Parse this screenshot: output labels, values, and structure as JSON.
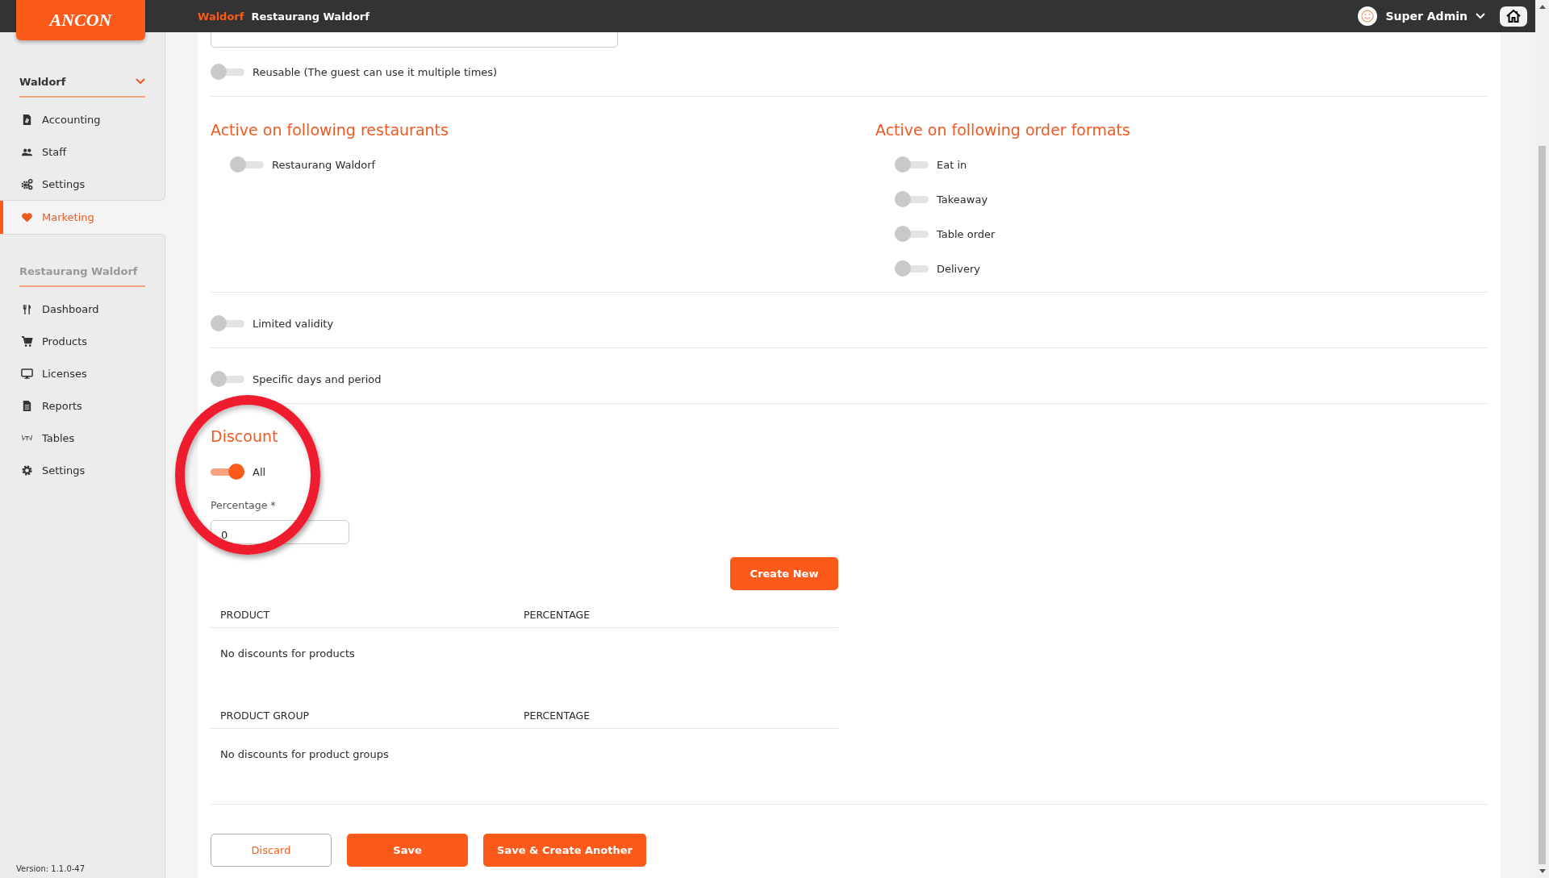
{
  "header": {
    "logo": "ANCON",
    "breadcrumb": [
      {
        "text": "Waldorf",
        "highlighted": true
      },
      {
        "text": "Restaurang Waldorf",
        "highlighted": false
      }
    ],
    "user": "Super Admin"
  },
  "sidebar": {
    "groups": [
      {
        "title": "Waldorf",
        "collapsible": true,
        "items": [
          {
            "label": "Accounting",
            "selected": false
          },
          {
            "label": "Staff",
            "selected": false
          },
          {
            "label": "Settings",
            "selected": false
          }
        ]
      },
      {
        "title": "Marketing",
        "kind": "link",
        "selected": true
      },
      {
        "title": "Restaurang Waldorf",
        "collapsible": false,
        "items": [
          {
            "label": "Dashboard",
            "selected": false
          },
          {
            "label": "Products",
            "selected": false
          },
          {
            "label": "Licenses",
            "selected": false
          },
          {
            "label": "Reports",
            "selected": false
          },
          {
            "label": "Tables",
            "selected": false
          },
          {
            "label": "Settings",
            "selected": false
          }
        ]
      }
    ],
    "version": "Version: 1.1.0-47"
  },
  "form": {
    "reusable": {
      "label": "Reusable (The guest can use it multiple times)",
      "on": false
    },
    "restaurants": {
      "title": "Active on following restaurants",
      "items": [
        {
          "label": "Restaurang Waldorf",
          "on": false
        }
      ]
    },
    "order_formats": {
      "title": "Active on following order formats",
      "items": [
        {
          "label": "Eat in",
          "on": false
        },
        {
          "label": "Takeaway",
          "on": false
        },
        {
          "label": "Table order",
          "on": false
        },
        {
          "label": "Delivery",
          "on": false
        }
      ]
    },
    "limited_validity": {
      "label": "Limited validity",
      "on": false
    },
    "specific_days": {
      "label": "Specific days and period",
      "on": false
    },
    "discount": {
      "title": "Discount",
      "all": {
        "label": "All",
        "on": true
      },
      "percentage": {
        "label": "Percentage *",
        "value": "0"
      },
      "create_button": "Create New",
      "tables": [
        {
          "columns": [
            "PRODUCT",
            "PERCENTAGE"
          ],
          "empty": "No discounts for products"
        },
        {
          "columns": [
            "PRODUCT GROUP",
            "PERCENTAGE"
          ],
          "empty": "No discounts for product groups"
        }
      ]
    },
    "buttons": [
      {
        "label": "Discard",
        "kind": "outline"
      },
      {
        "label": "Save",
        "kind": "primary"
      },
      {
        "label": "Save & Create Another",
        "kind": "primary"
      }
    ]
  },
  "annotation": {
    "kind": "circle"
  }
}
